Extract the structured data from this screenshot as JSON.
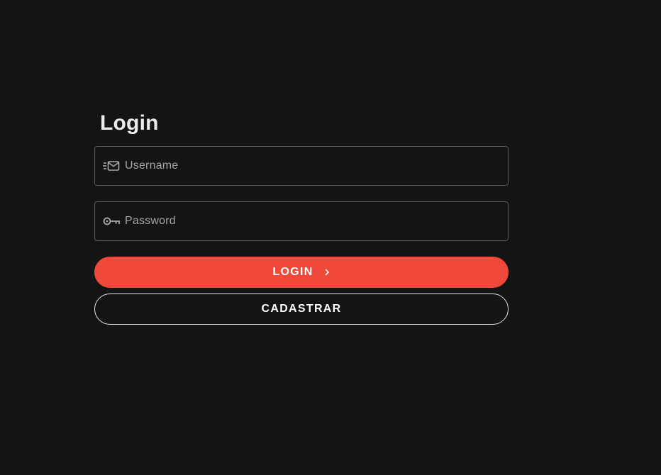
{
  "login": {
    "title": "Login",
    "username": {
      "placeholder": "Username",
      "value": "",
      "icon": "mail-list-icon"
    },
    "password": {
      "placeholder": "Password",
      "value": "",
      "icon": "key-icon"
    },
    "login_button": {
      "label": "LOGIN",
      "icon": "chevron-right-icon"
    },
    "register_button": {
      "label": "CADASTRAR"
    }
  },
  "colors": {
    "background": "#141414",
    "accent": "#f0483a",
    "field_border": "#5a5a5a",
    "placeholder": "#a4a4a4",
    "title": "#ececec"
  }
}
